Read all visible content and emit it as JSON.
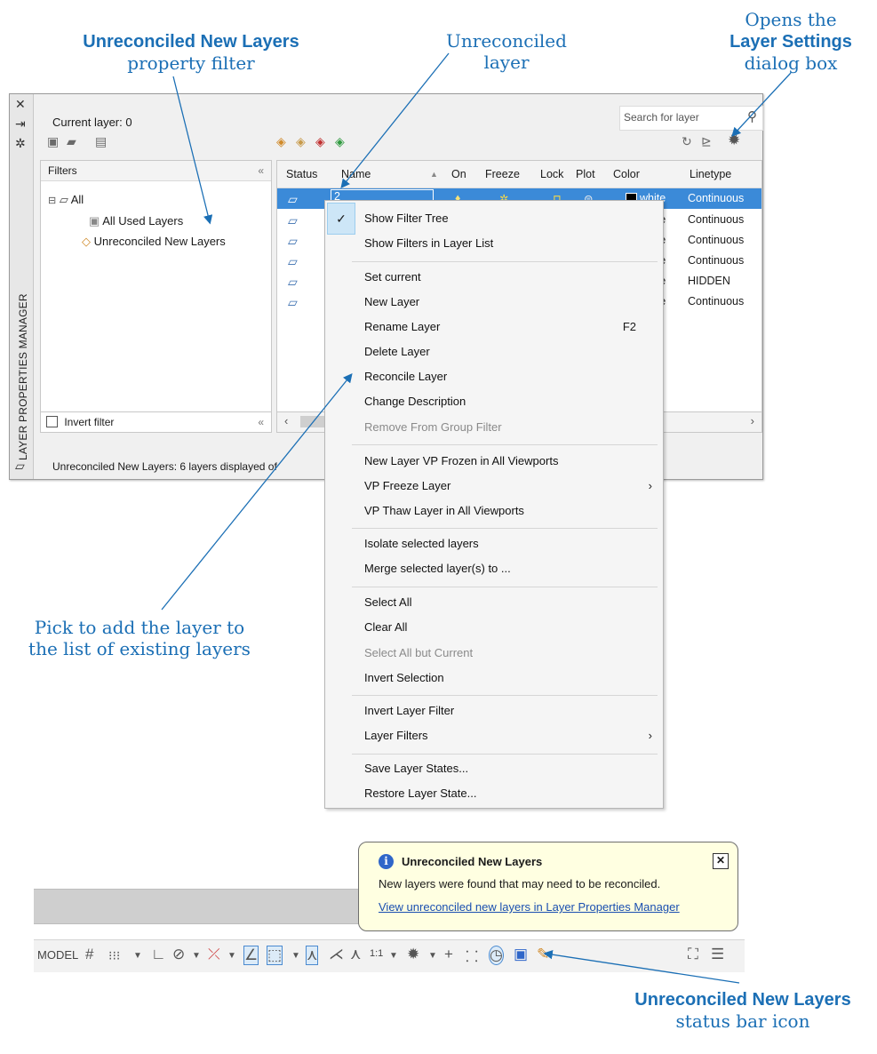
{
  "annotations": {
    "filter_bold": "Unreconciled New Layers",
    "filter_rest": "property filter",
    "unreconciled_layer": "Unreconciled layer",
    "settings_pre": "Opens the",
    "settings_bold": "Layer Settings",
    "settings_post": "dialog box",
    "pick": "Pick to add the layer to the list of existing layers",
    "statusicon_bold": "Unreconciled New Layers",
    "statusicon_rest": "status bar icon"
  },
  "palette": {
    "vertical_title": "LAYER PROPERTIES MANAGER",
    "current_layer": "Current layer: 0",
    "search_placeholder": "Search for layer",
    "filters_header": "Filters",
    "tree": {
      "root": "All",
      "items": [
        "All Used Layers",
        "Unreconciled New Layers"
      ]
    },
    "invert_filter": "Invert filter",
    "status_text": "Unreconciled New Layers: 6 layers displayed of",
    "columns": [
      "Status",
      "Name",
      "On",
      "Freeze",
      "Lock",
      "Plot",
      "Color",
      "Linetype"
    ],
    "rows": [
      {
        "name": "2",
        "color": "white",
        "linetype": "Continuous",
        "selected": true
      },
      {
        "name": "",
        "color": "white",
        "linetype": "Continuous"
      },
      {
        "name": "",
        "color": "white",
        "linetype": "Continuous"
      },
      {
        "name": "",
        "color": "white",
        "linetype": "Continuous"
      },
      {
        "name": "",
        "color": "white",
        "linetype": "HIDDEN"
      },
      {
        "name": "",
        "color": "white",
        "linetype": "Continuous"
      }
    ]
  },
  "menu": {
    "items": [
      "Show Filter Tree",
      "Show Filters in Layer List",
      "Set current",
      "New Layer",
      "Rename Layer",
      "Delete Layer",
      "Reconcile Layer",
      "Change Description",
      "Remove From Group Filter",
      "New Layer VP Frozen in All Viewports",
      "VP Freeze Layer",
      "VP Thaw Layer in All Viewports",
      "Isolate selected layers",
      "Merge selected layer(s) to ...",
      "Select All",
      "Clear All",
      "Select All but Current",
      "Invert Selection",
      "Invert Layer Filter",
      "Layer Filters",
      "Save Layer States...",
      "Restore Layer State..."
    ],
    "rename_shortcut": "F2"
  },
  "balloon": {
    "title": "Unreconciled New Layers",
    "message": "New layers were found that may need to be reconciled.",
    "link": "View unreconciled new layers in Layer Properties Manager"
  },
  "statusbar": {
    "model": "MODEL",
    "scale": "1:1"
  },
  "colors": {
    "annotation": "#1b6fb5",
    "selection": "#3b8ad8",
    "balloon": "#ffffe1"
  }
}
